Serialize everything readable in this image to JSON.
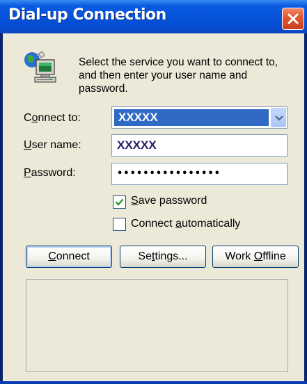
{
  "window": {
    "title": "Dial-up Connection",
    "close_icon": "close-icon"
  },
  "intro": {
    "icon": "dialup-computer-icon",
    "text": "Select the service you want to connect to, and then enter your user name and password."
  },
  "form": {
    "connect_to": {
      "label_prefix": "C",
      "label_ul": "o",
      "label_rest": "nnect to:",
      "value": "XXXXX"
    },
    "user_name": {
      "label_ul": "U",
      "label_rest": "ser name:",
      "value": "XXXXX"
    },
    "password": {
      "label_ul": "P",
      "label_rest": "assword:",
      "value": "••••••••••••••••"
    }
  },
  "options": {
    "save_password": {
      "label_ul": "S",
      "label_rest": "ave password",
      "checked": true
    },
    "connect_automatically": {
      "label_prefix": "Connect ",
      "label_ul": "a",
      "label_rest": "utomatically",
      "checked": false
    }
  },
  "buttons": {
    "connect": {
      "label_ul": "C",
      "label_rest": "onnect"
    },
    "settings": {
      "label_prefix": "Se",
      "label_ul": "t",
      "label_rest": "tings..."
    },
    "work_offline": {
      "label_prefix": "Work ",
      "label_ul": "O",
      "label_rest": "ffline"
    }
  },
  "colors": {
    "title_bar": "#0551d8",
    "selection": "#316ac5",
    "dialog_bg": "#ece9d8",
    "close_button": "#e0552e"
  }
}
